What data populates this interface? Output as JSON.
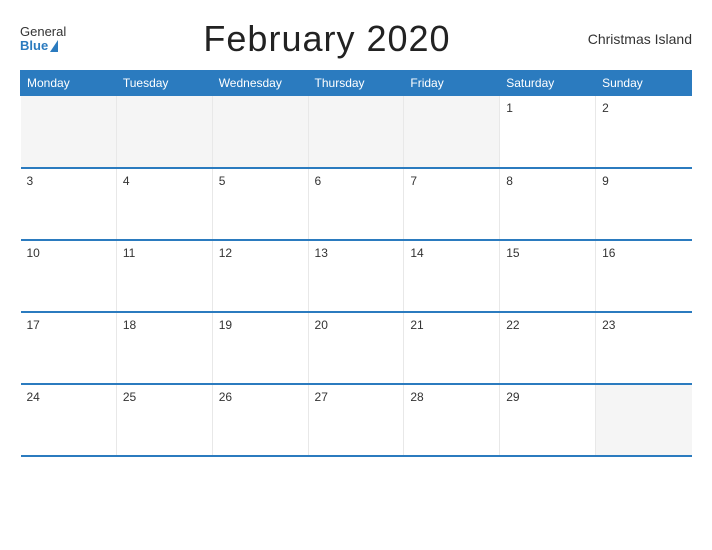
{
  "header": {
    "title": "February 2020",
    "location": "Christmas Island",
    "logo": {
      "general": "General",
      "blue": "Blue"
    }
  },
  "weekdays": [
    "Monday",
    "Tuesday",
    "Wednesday",
    "Thursday",
    "Friday",
    "Saturday",
    "Sunday"
  ],
  "weeks": [
    [
      null,
      null,
      null,
      null,
      null,
      1,
      2
    ],
    [
      3,
      4,
      5,
      6,
      7,
      8,
      9
    ],
    [
      10,
      11,
      12,
      13,
      14,
      15,
      16
    ],
    [
      17,
      18,
      19,
      20,
      21,
      22,
      23
    ],
    [
      24,
      25,
      26,
      27,
      28,
      29,
      null
    ]
  ]
}
